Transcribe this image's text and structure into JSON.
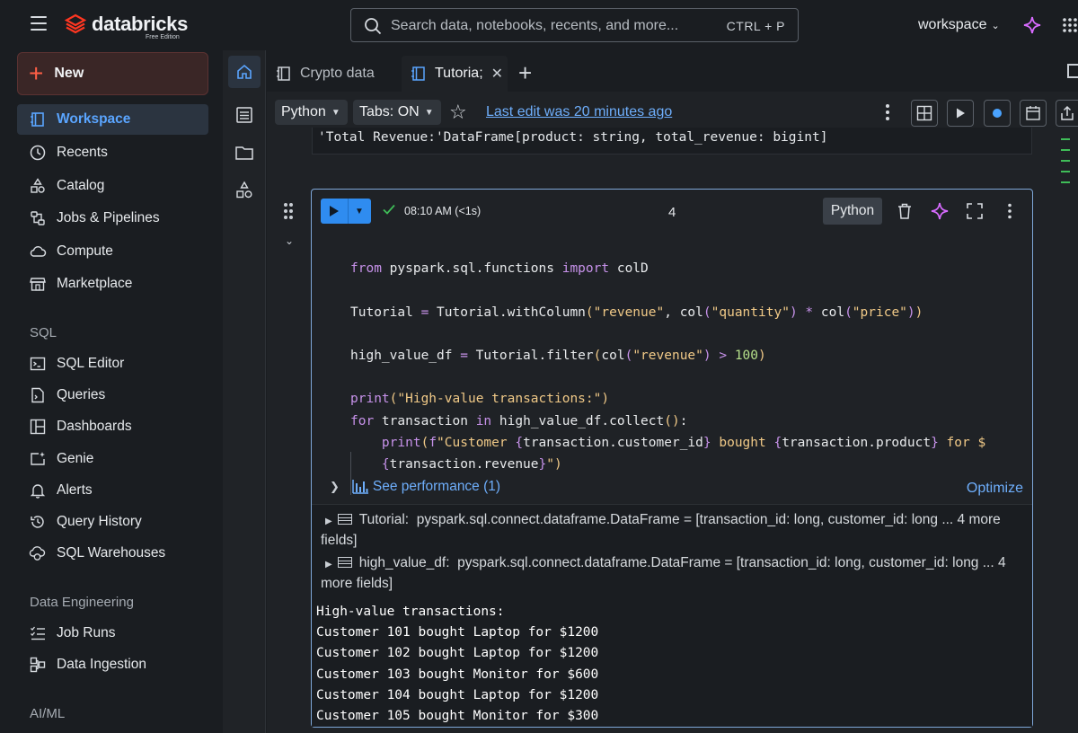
{
  "header": {
    "brand": "databricks",
    "edition": "Free Edition",
    "search_placeholder": "Search data, notebooks, recents, and more...",
    "search_shortcut": "CTRL + P",
    "workspace_label": "workspace"
  },
  "sidebar": {
    "new_label": "New",
    "items": [
      {
        "label": "Workspace",
        "icon": "notebook-icon",
        "active": true
      },
      {
        "label": "Recents",
        "icon": "clock-icon"
      },
      {
        "label": "Catalog",
        "icon": "catalog-icon"
      },
      {
        "label": "Jobs & Pipelines",
        "icon": "jobs-icon"
      },
      {
        "label": "Compute",
        "icon": "cloud-icon"
      },
      {
        "label": "Marketplace",
        "icon": "store-icon"
      }
    ],
    "sql_section": "SQL",
    "sql_items": [
      {
        "label": "SQL Editor",
        "icon": "terminal-icon"
      },
      {
        "label": "Queries",
        "icon": "query-icon"
      },
      {
        "label": "Dashboards",
        "icon": "dashboard-icon"
      },
      {
        "label": "Genie",
        "icon": "genie-icon"
      },
      {
        "label": "Alerts",
        "icon": "bell-icon"
      },
      {
        "label": "Query History",
        "icon": "history-icon"
      },
      {
        "label": "SQL Warehouses",
        "icon": "warehouse-icon"
      }
    ],
    "de_section": "Data Engineering",
    "de_items": [
      {
        "label": "Job Runs",
        "icon": "list-check-icon"
      },
      {
        "label": "Data Ingestion",
        "icon": "ingestion-icon"
      }
    ],
    "ml_section": "AI/ML"
  },
  "tabs": [
    {
      "label": "Crypto data",
      "active": false
    },
    {
      "label": "Tutoria;",
      "active": true
    }
  ],
  "toolbar": {
    "language": "Python",
    "tabs_mode": "Tabs: ON",
    "last_edit": "Last edit was 20 minutes ago"
  },
  "previous_output": "'Total Revenue:'DataFrame[product: string, total_revenue: bigint]",
  "cell": {
    "run_time": "08:10 AM (<1s)",
    "number": "4",
    "language": "Python",
    "perf_label": "See performance (1)",
    "optimize_label": "Optimize",
    "dataframes": [
      {
        "name": "Tutorial:",
        "schema": "pyspark.sql.connect.dataframe.DataFrame = [transaction_id: long, customer_id: long ... 4 more fields]"
      },
      {
        "name": "high_value_df:",
        "schema": "pyspark.sql.connect.dataframe.DataFrame = [transaction_id: long, customer_id: long ... 4 more fields]"
      }
    ],
    "stdout": "High-value transactions:\nCustomer 101 bought Laptop for $1200\nCustomer 102 bought Laptop for $1200\nCustomer 103 bought Monitor for $600\nCustomer 104 bought Laptop for $1200\nCustomer 105 bought Monitor for $300"
  },
  "code_lines": {
    "l1": "from pyspark.sql.functions import colD",
    "l2": "Tutorial = Tutorial.withColumn(\"revenue\", col(\"quantity\") * col(\"price\"))",
    "l3": "high_value_df = Tutorial.filter(col(\"revenue\") > 100)",
    "l4": "print(\"High-value transactions:\")",
    "l5": "for transaction in high_value_df.collect():",
    "l6": "    print(f\"Customer {transaction.customer_id} bought {transaction.product} for $",
    "l7": "    {transaction.revenue}\")"
  },
  "colors": {
    "accent_blue": "#2f8cf0",
    "brand_red": "#ff3621",
    "link": "#6eaefb",
    "success": "#3fbd58"
  }
}
